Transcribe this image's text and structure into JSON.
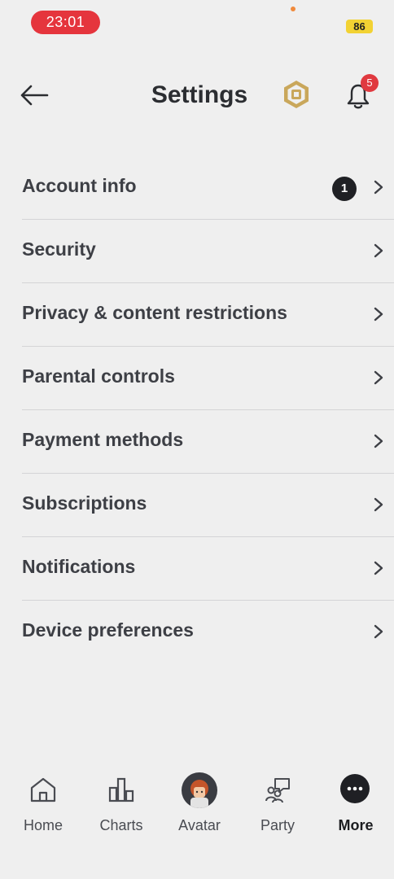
{
  "status": {
    "time": "23:01",
    "battery": "86"
  },
  "header": {
    "title": "Settings",
    "notification_count": "5"
  },
  "menu": {
    "items": [
      {
        "label": "Account info",
        "badge": "1"
      },
      {
        "label": "Security"
      },
      {
        "label": "Privacy & content restrictions"
      },
      {
        "label": "Parental controls"
      },
      {
        "label": "Payment methods"
      },
      {
        "label": "Subscriptions"
      },
      {
        "label": "Notifications"
      },
      {
        "label": "Device preferences"
      }
    ]
  },
  "tabs": {
    "home": "Home",
    "charts": "Charts",
    "avatar": "Avatar",
    "party": "Party",
    "more": "More"
  },
  "colors": {
    "time_pill": "#e5353d",
    "badge_red": "#e0393f",
    "battery": "#f2d233",
    "background": "#efefef"
  }
}
